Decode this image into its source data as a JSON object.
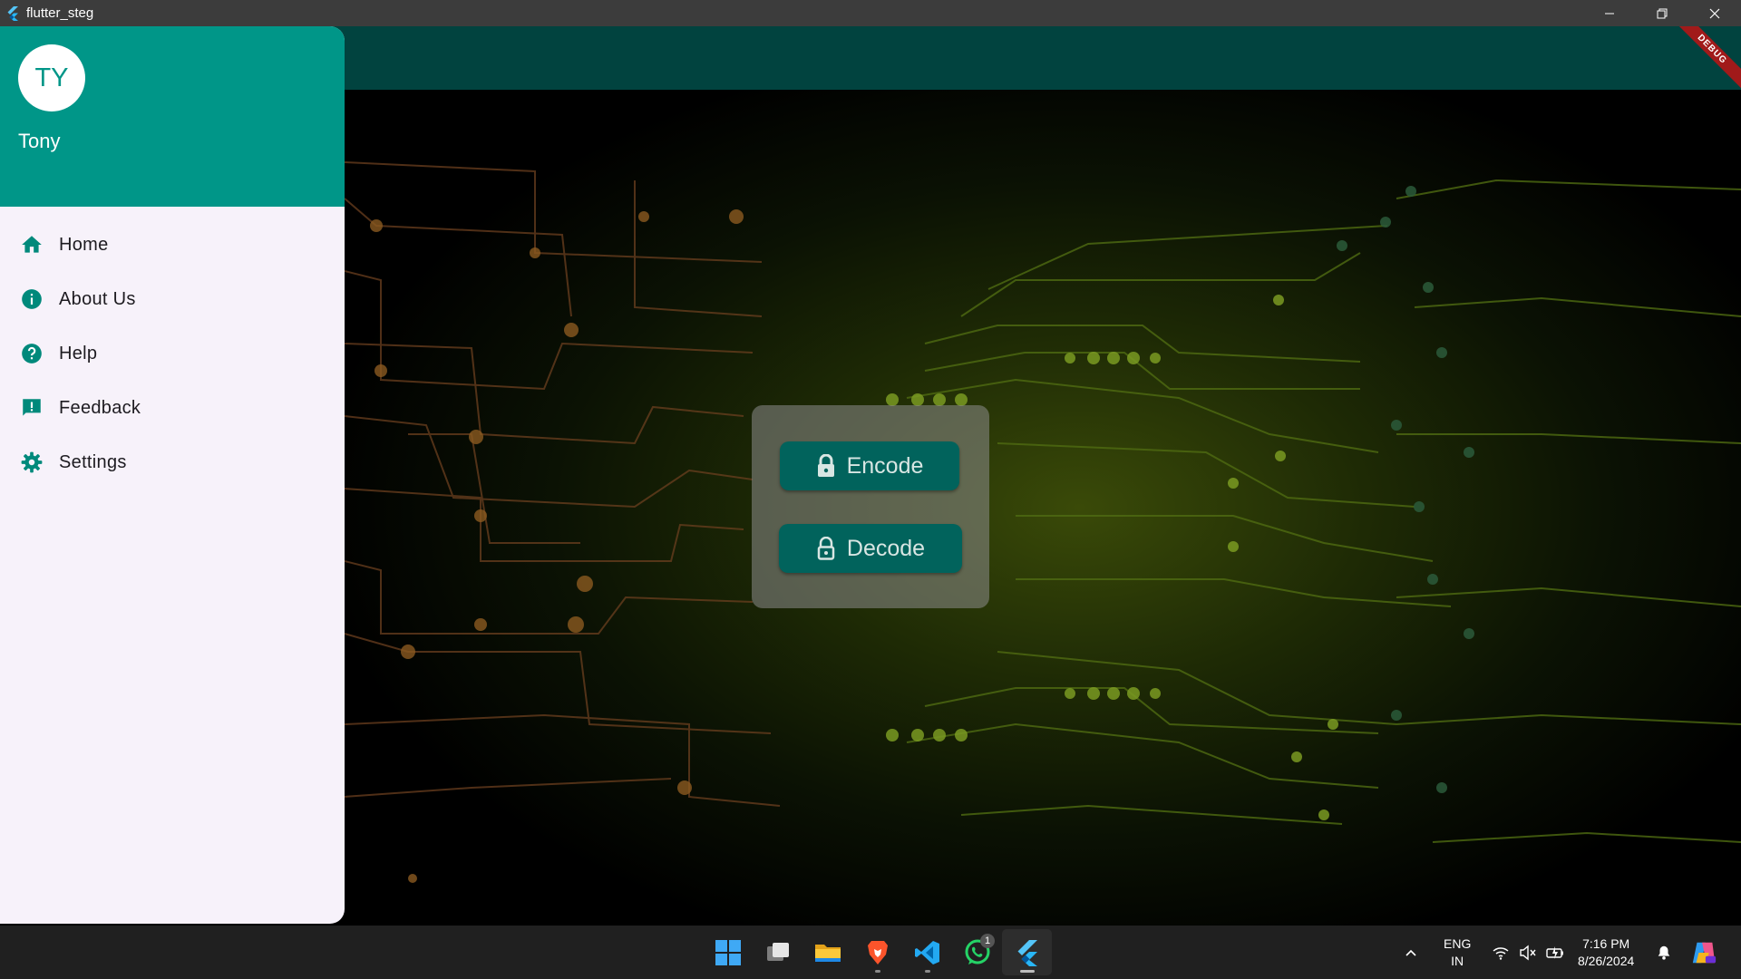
{
  "window": {
    "title": "flutter_steg",
    "controls": [
      "minimize-icon",
      "restore-icon",
      "close-icon"
    ]
  },
  "debug_banner": "DEBUG",
  "drawer": {
    "avatar_initials": "TY",
    "user_name": "Tony",
    "items": [
      {
        "label": "Home",
        "icon": "home-icon"
      },
      {
        "label": "About Us",
        "icon": "info-icon"
      },
      {
        "label": "Help",
        "icon": "help-icon"
      },
      {
        "label": "Feedback",
        "icon": "feedback-icon"
      },
      {
        "label": "Settings",
        "icon": "settings-icon"
      }
    ]
  },
  "main": {
    "encode_label": "Encode",
    "decode_label": "Decode"
  },
  "taskbar": {
    "apps": [
      "windows-start-icon",
      "task-view-icon",
      "file-explorer-icon",
      "brave-browser-icon",
      "vscode-icon",
      "whatsapp-icon",
      "flutter-app-icon"
    ],
    "whatsapp_badge": "1",
    "lang_line1": "ENG",
    "lang_line2": "IN",
    "time": "7:16 PM",
    "date": "8/26/2024"
  },
  "colors": {
    "primary": "#009688",
    "appbar": "#01433f",
    "button": "#01635c",
    "drawer_bg": "#f7f2fa",
    "debug": "#a11a1a"
  }
}
